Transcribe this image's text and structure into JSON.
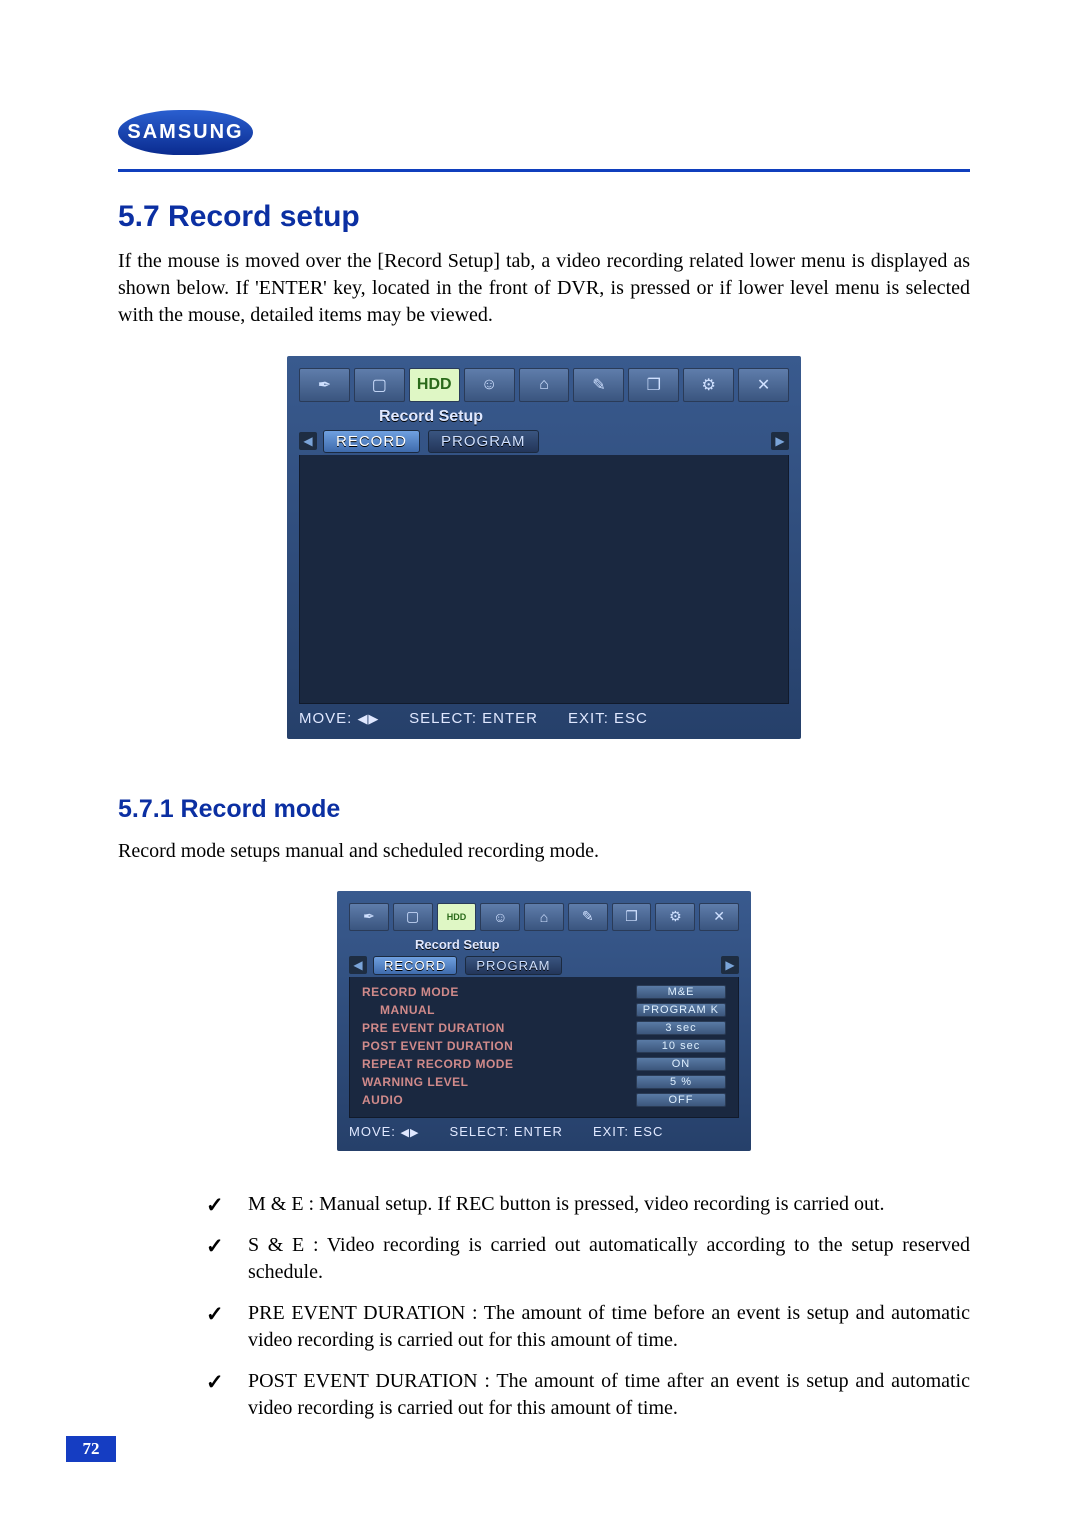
{
  "logo_text": "SAMSUNG",
  "heading1": "5.7 Record setup",
  "para1": "If the mouse is moved over the [Record Setup] tab, a video recording related lower menu is displayed as shown below. If 'ENTER' key, located in the front of DVR, is pressed or if lower level menu is selected with the mouse, detailed items may be viewed.",
  "fig1": {
    "title": "Record Setup",
    "tabs": [
      "RECORD",
      "PROGRAM"
    ],
    "status": {
      "move": "MOVE:",
      "select": "SELECT: ENTER",
      "exit": "EXIT: ESC"
    }
  },
  "heading2": "5.7.1 Record mode",
  "para2": "Record mode setups  manual  and  scheduled  recording  mode.",
  "fig2": {
    "title": "Record Setup",
    "tabs": [
      "RECORD",
      "PROGRAM"
    ],
    "rows": [
      {
        "label": "RECORD MODE",
        "value": "M&E",
        "indent": false
      },
      {
        "label": "MANUAL",
        "value": "PROGRAM K",
        "indent": true
      },
      {
        "label": "PRE EVENT DURATION",
        "value": "3 sec",
        "indent": false
      },
      {
        "label": "POST EVENT DURATION",
        "value": "10 sec",
        "indent": false
      },
      {
        "label": "REPEAT RECORD MODE",
        "value": "ON",
        "indent": false
      },
      {
        "label": "WARNING LEVEL",
        "value": "5 %",
        "indent": false
      },
      {
        "label": "AUDIO",
        "value": "OFF",
        "indent": false
      }
    ],
    "status": {
      "move": "MOVE:",
      "select": "SELECT: ENTER",
      "exit": "EXIT: ESC"
    }
  },
  "bullets": [
    "M & E : Manual setup. If REC button is pressed, video recording is carried out.",
    "S & E : Video recording is carried out automatically according to the setup reserved schedule.",
    "PRE EVENT DURATION : The amount of time before an event is setup and automatic video recording is carried out for this amount of time.",
    "POST EVENT DURATION : The amount of time after an event is setup and automatic video recording is carried out for this amount of time."
  ],
  "page_number": "72",
  "icons": {
    "wrench": "✒",
    "monitor": "▢",
    "hdd": "HDD",
    "people": "☺",
    "padlock": "⌂",
    "pencil": "✎",
    "doc": "❐",
    "net": "⚙",
    "close": "✕"
  },
  "arrow_left": "◀",
  "arrow_right": "▶",
  "arrows_lr": "◀▶"
}
